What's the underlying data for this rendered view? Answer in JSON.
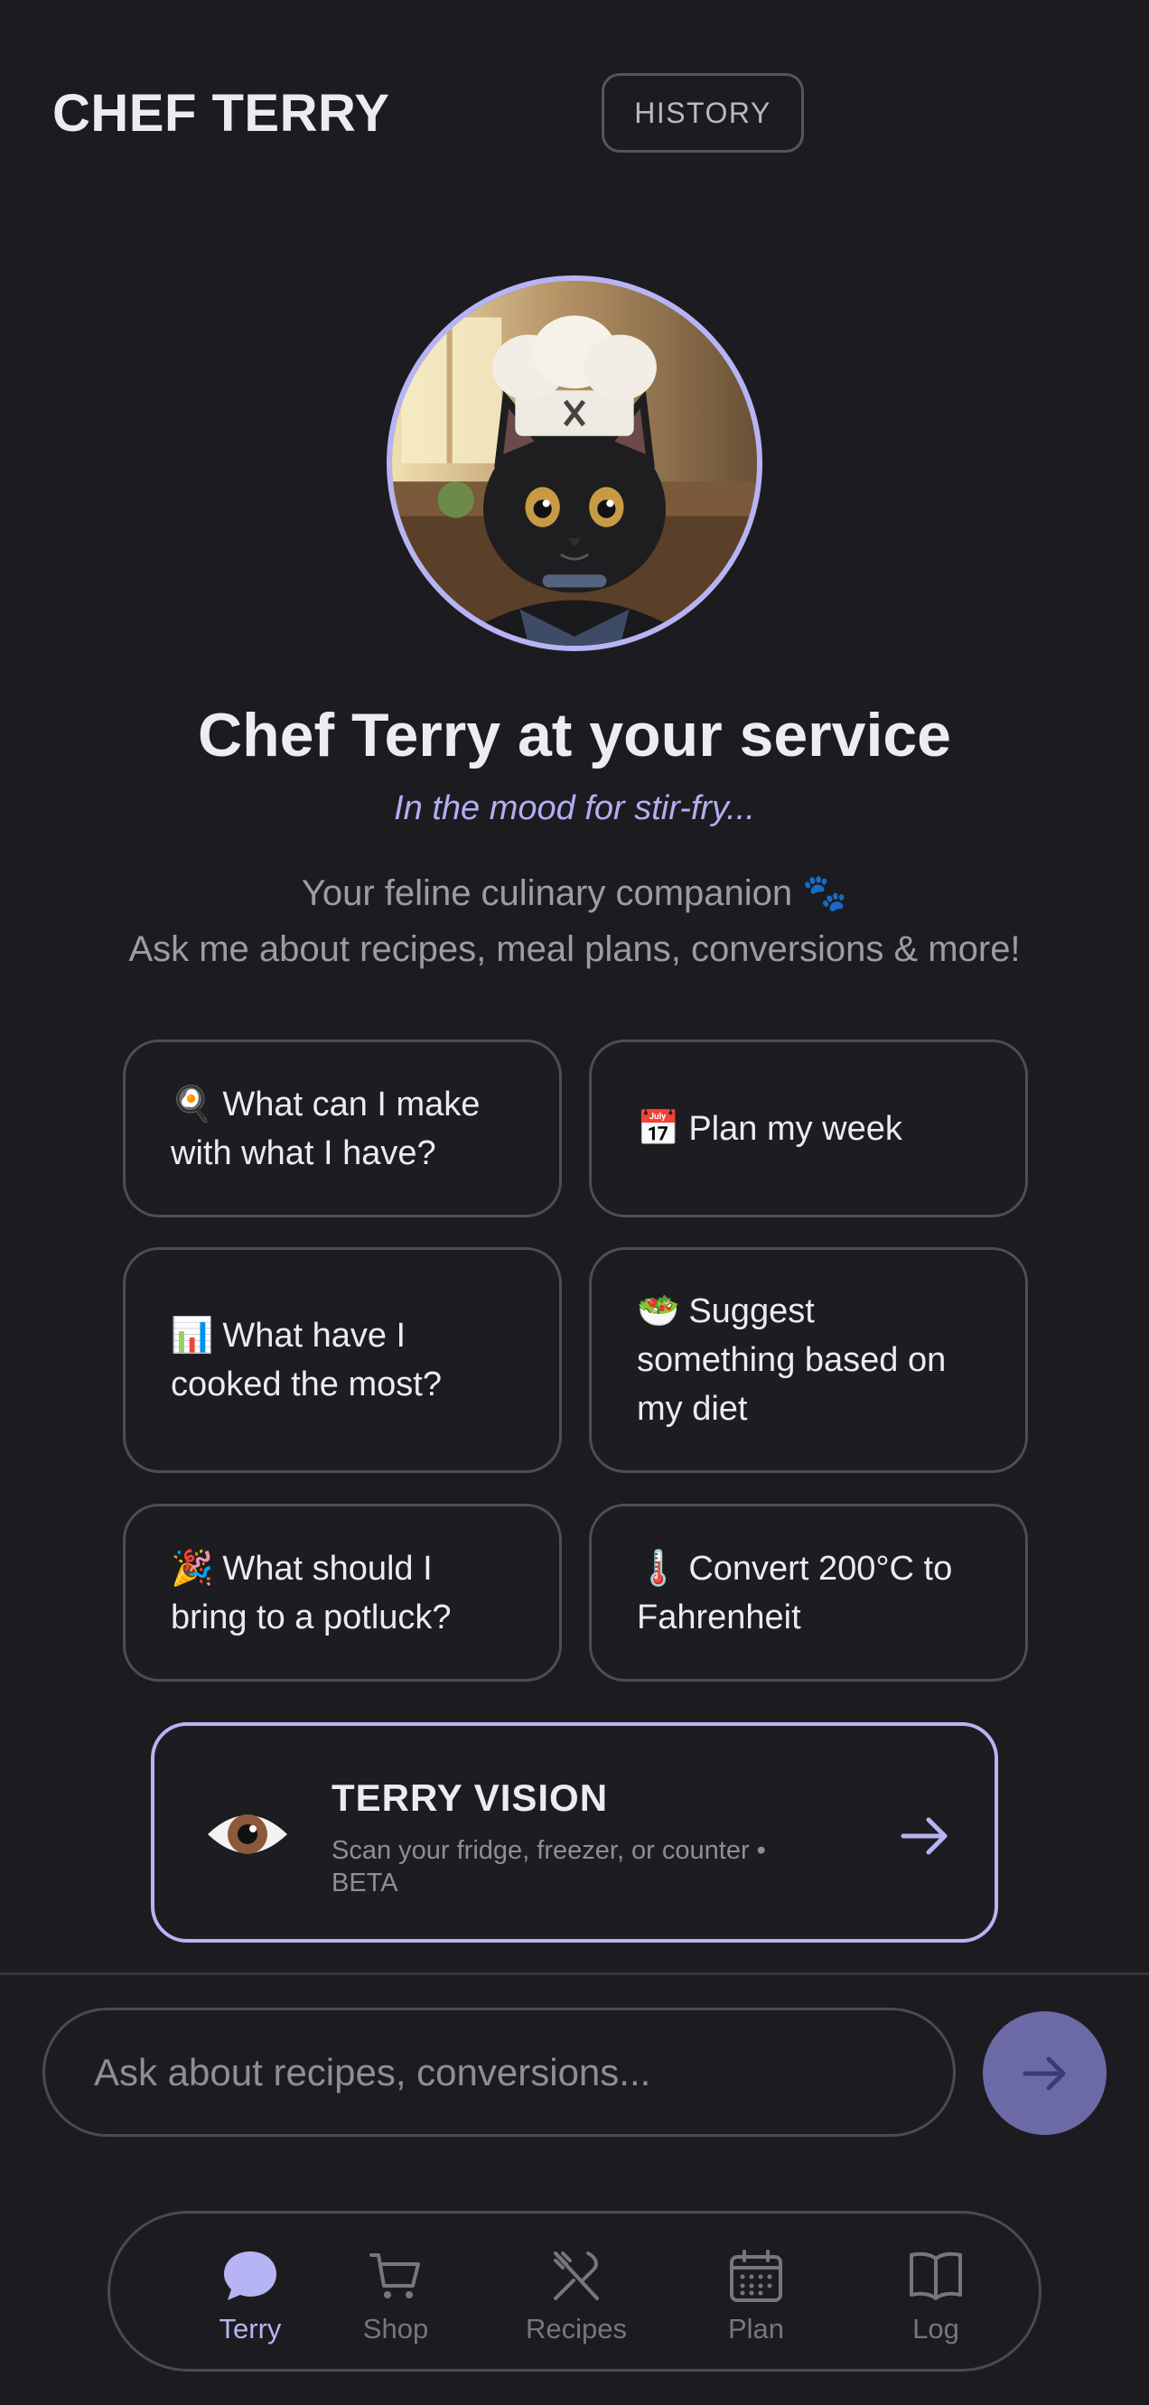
{
  "header": {
    "title": "CHEF TERRY",
    "history_label": "HISTORY"
  },
  "hero": {
    "title": "Chef Terry at your service",
    "mood": "In the mood for stir-fry...",
    "tagline_line1": "Your feline culinary companion",
    "tagline_icon": "🐾",
    "tagline_line2": "Ask me about recipes, meal plans, conversions & more!"
  },
  "suggestions": [
    {
      "icon": "🍳",
      "text": "What can I make with what I have?"
    },
    {
      "icon": "📅",
      "text": "Plan my week"
    },
    {
      "icon": "📊",
      "text": "What have I cooked the most?"
    },
    {
      "icon": "🥗",
      "text": "Suggest something based on my diet"
    },
    {
      "icon": "🎉",
      "text": "What should I bring to a potluck?"
    },
    {
      "icon": "🌡️",
      "text": "Convert 200°C to Fahrenheit"
    }
  ],
  "vision": {
    "title": "TERRY VISION",
    "subtitle": "Scan your fridge, freezer, or counter • BETA",
    "icon": "eye-icon"
  },
  "chat": {
    "placeholder": "Ask about recipes, conversions...",
    "send_icon": "arrow-right-icon"
  },
  "nav": [
    {
      "label": "Terry",
      "icon": "chat-bubble-icon",
      "active": true
    },
    {
      "label": "Shop",
      "icon": "cart-icon",
      "active": false
    },
    {
      "label": "Recipes",
      "icon": "utensils-icon",
      "active": false
    },
    {
      "label": "Plan",
      "icon": "calendar-icon",
      "active": false
    },
    {
      "label": "Log",
      "icon": "book-icon",
      "active": false
    }
  ],
  "colors": {
    "background": "#1c1c20",
    "accent": "#b7b4f5",
    "send_button": "#6c6aa6",
    "muted_text": "#76767d"
  }
}
